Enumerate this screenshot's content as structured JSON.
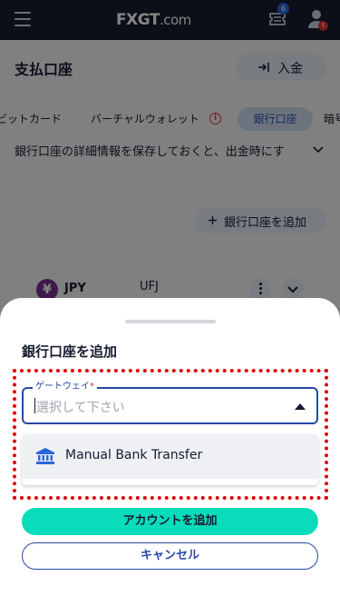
{
  "header": {
    "logo_text": "FXGT",
    "logo_domain": ".com",
    "ticket_badge": "6",
    "user_badge": "!"
  },
  "page": {
    "title": "支払口座",
    "deposit_label": "入金",
    "tabs": [
      {
        "label": "ビットカード"
      },
      {
        "label": "バーチャルウォレット",
        "info": "i"
      },
      {
        "label": "銀行口座",
        "active": true
      },
      {
        "label": "暗号"
      }
    ],
    "info_text": "銀行口座の詳細情報を保存しておくと、出金時にす",
    "add_bank_label": "銀行口座を追加",
    "account": {
      "currency_symbol": "¥",
      "currency": "JPY",
      "bank": "UFJ"
    }
  },
  "sheet": {
    "title": "銀行口座を追加",
    "gateway": {
      "label": "ゲートウェイ",
      "required_mark": "*",
      "placeholder": "選択して下さい"
    },
    "options": [
      {
        "label": "Manual Bank Transfer",
        "icon": "bank-icon"
      }
    ],
    "add_account_label": "アカウントを追加",
    "cancel_label": "キャンセル"
  },
  "colors": {
    "header_bg": "#171b2e",
    "accent_blue": "#2748a8",
    "primary_button": "#08dcba",
    "highlight_border": "#e00000",
    "jpy_icon": "#7a2f93"
  }
}
